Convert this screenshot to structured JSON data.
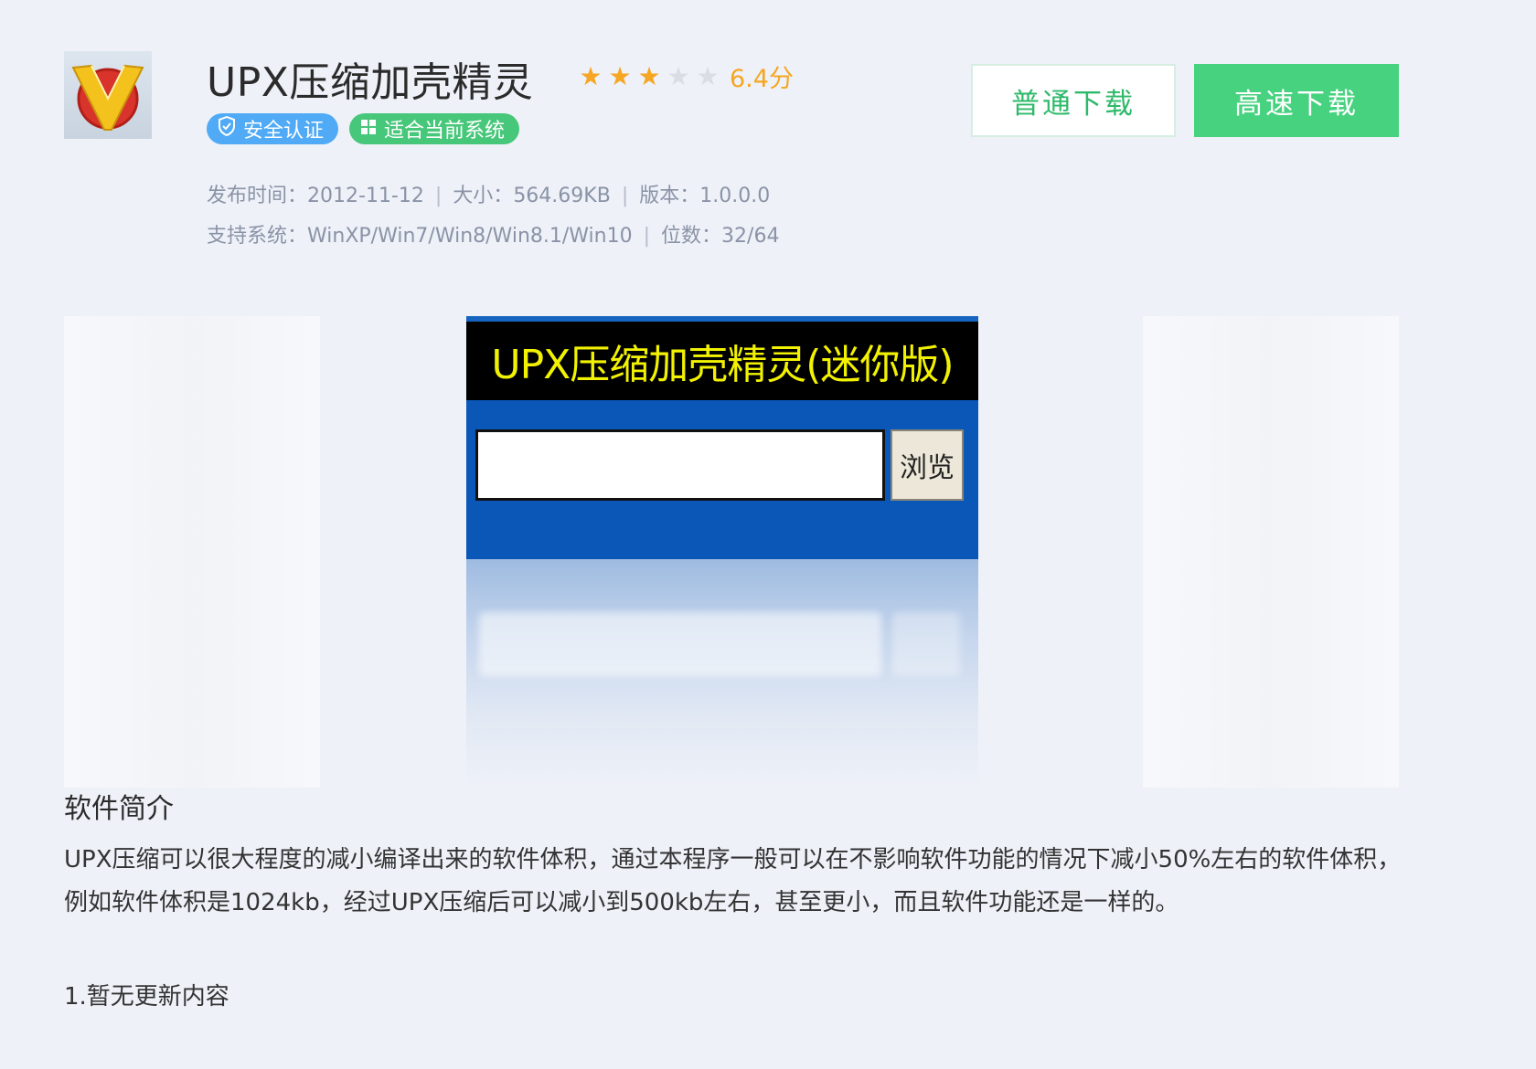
{
  "app": {
    "name": "UPX压缩加壳精灵",
    "score": "6.4分",
    "rating": {
      "value": 3,
      "max": 5
    },
    "badges": [
      "安全认证",
      "适合当前系统"
    ]
  },
  "meta": {
    "release_label": "发布时间：",
    "release_value": "2012-11-12",
    "size_label": "大小：",
    "size_value": "564.69KB",
    "version_label": "版本：",
    "version_value": "1.0.0.0",
    "os_label": "支持系统：",
    "os_value": "WinXP/Win7/Win8/Win8.1/Win10",
    "bits_label": "位数：",
    "bits_value": "32/64"
  },
  "buttons": {
    "normal_download": "普通下载",
    "fast_download": "高速下载"
  },
  "screenshot": {
    "title": "UPX压缩加壳精灵(迷你版)",
    "browse": "浏览"
  },
  "intro": {
    "title": "软件简介",
    "text": "UPX压缩可以很大程度的减小编译出来的软件体积，通过本程序一般可以在不影响软件功能的情况下减小50%左右的软件体积，例如软件体积是1024kb，经过UPX压缩后可以减小到500kb左右，甚至更小，而且软件功能还是一样的。",
    "update": "1.暂无更新内容"
  },
  "colors": {
    "accent_green": "#47d280",
    "star": "#f5a623",
    "badge_blue": "#50aaf5",
    "badge_green": "#47c77a"
  }
}
